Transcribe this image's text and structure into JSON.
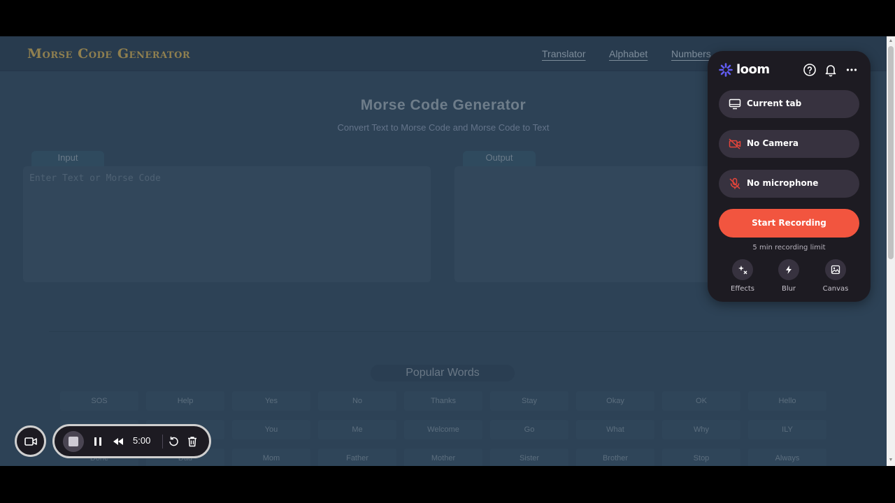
{
  "site": {
    "logo": "Morse Code Generator",
    "nav": [
      "Translator",
      "Alphabet",
      "Numbers"
    ],
    "title": "Morse Code Generator",
    "subtitle": "Convert Text to Morse Code and Morse Code to Text",
    "input_label": "Input",
    "input_placeholder": "Enter Text or Morse Code",
    "output_label": "Output",
    "popular_heading": "Popular Words",
    "popular_words": [
      [
        "SOS",
        "Help",
        "Yes",
        "No",
        "Thanks",
        "Stay",
        "Okay",
        "OK",
        "Hello"
      ],
      [
        "",
        "",
        "You",
        "Me",
        "Welcome",
        "Go",
        "What",
        "Why",
        "ILY"
      ],
      [
        "Done",
        "Dad",
        "Mom",
        "Father",
        "Mother",
        "Sister",
        "Brother",
        "Stop",
        "Always"
      ]
    ]
  },
  "loom": {
    "brand": "loom",
    "icons": [
      "help-circle-icon",
      "bell-icon",
      "more-horizontal-icon"
    ],
    "options": [
      {
        "label": "Current tab",
        "icon": "monitor-icon"
      },
      {
        "label": "No Camera",
        "icon": "camera-off-icon"
      },
      {
        "label": "No microphone",
        "icon": "mic-off-icon"
      }
    ],
    "start_label": "Start Recording",
    "limit_text": "5 min recording limit",
    "tools": [
      {
        "label": "Effects",
        "icon": "sparkles-icon"
      },
      {
        "label": "Blur",
        "icon": "lightning-icon"
      },
      {
        "label": "Canvas",
        "icon": "image-icon"
      }
    ],
    "accent_color": "#f2553f",
    "brand_color": "#625df5"
  },
  "recorder": {
    "timer": "5:00"
  }
}
